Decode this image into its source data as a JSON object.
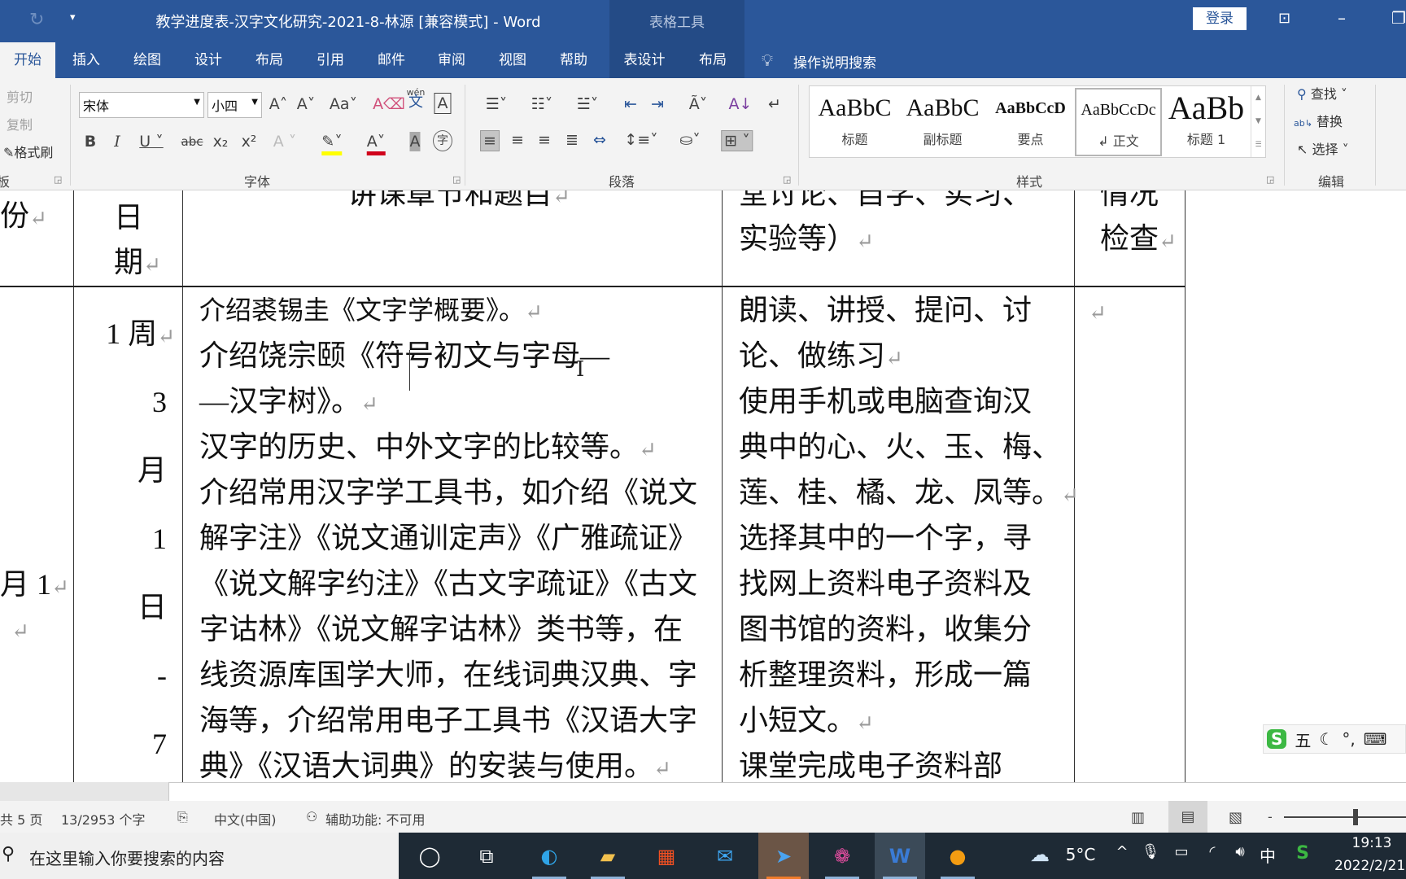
{
  "titlebar": {
    "title": "教学进度表-汉字文化研究-2021-8-林源 [兼容模式]  -  Word",
    "context_group": "表格工具",
    "signin": "登录",
    "qat_customize": "▾"
  },
  "tabs": [
    {
      "label": "开始",
      "selected": true
    },
    {
      "label": "插入"
    },
    {
      "label": "绘图"
    },
    {
      "label": "设计"
    },
    {
      "label": "布局"
    },
    {
      "label": "引用"
    },
    {
      "label": "邮件"
    },
    {
      "label": "审阅"
    },
    {
      "label": "视图"
    },
    {
      "label": "帮助"
    },
    {
      "label": "表设计"
    },
    {
      "label": "布局"
    }
  ],
  "tell_me": "操作说明搜索",
  "ribbon": {
    "clipboard": {
      "cut": "剪切",
      "copy": "复制",
      "format_painter": "格式刷",
      "label": "板"
    },
    "font": {
      "name": "宋体",
      "size": "小四",
      "label": "字体",
      "change_case": "Aa",
      "phonetic": "wén"
    },
    "paragraph": {
      "label": "段落"
    },
    "styles": {
      "label": "样式",
      "items": [
        {
          "preview": "AaBbC",
          "name": "标题"
        },
        {
          "preview": "AaBbC",
          "name": "副标题"
        },
        {
          "preview": "AaBbCcD",
          "name": "要点"
        },
        {
          "preview": "AaBbCcDc",
          "name": "↲ 正文",
          "selected": true
        },
        {
          "preview": "AaBb",
          "name": "标题 1"
        }
      ]
    },
    "editing": {
      "find": "查找",
      "replace": "替换",
      "select": "选择",
      "label": "编辑"
    }
  },
  "document": {
    "pilcrow": "↵",
    "header": {
      "col1": "份",
      "col2": [
        "日",
        "期"
      ],
      "col3": "讲课章节和题目",
      "col4": [
        "堂讨论、自学、实习、",
        "实验等）"
      ],
      "col5": [
        "情况",
        "检查"
      ]
    },
    "row1": {
      "col1": [
        "月 1",
        ""
      ],
      "col2": [
        "1 周",
        "3",
        "月",
        "1",
        "日",
        "-",
        "7"
      ],
      "col3": [
        "介绍裘锡圭《文字学概要》。",
        "介绍饶宗颐《符号初文与字母—",
        "—汉字树》。",
        "汉字的历史、中外文字的比较等。",
        "介绍常用汉字学工具书，如介绍《说文",
        "解字注》《说文通训定声》《广雅疏证》",
        "《说文解字约注》《古文字疏证》《古文",
        "字诂林》《说文解字诂林》类书等，在",
        "线资源库国学大师，在线词典汉典、字",
        "海等，介绍常用电子工具书《汉语大字",
        "典》《汉语大词典》的安装与使用。"
      ],
      "col4": [
        "朗读、讲授、提问、讨",
        "论、做练习",
        "使用手机或电脑查询汉",
        "典中的心、火、玉、梅、",
        "莲、桂、橘、龙、凤等。",
        "选择其中的一个字，寻",
        "找网上资料电子资料及",
        "图书馆的资料，收集分",
        "析整理资料，形成一篇",
        "小短文。",
        "课堂完成电子资料部"
      ],
      "col5": [
        ""
      ]
    }
  },
  "statusbar": {
    "pages": "共 5 页",
    "words": "13/2953 个字",
    "language": "中文(中国)",
    "accessibility": "辅助功能: 不可用"
  },
  "taskbar": {
    "search_placeholder": "在这里输入你要搜索的内容",
    "weather": "5°C",
    "ime": "中",
    "time": "19:13",
    "date": "2022/2/21"
  },
  "ime_toolbar": {
    "mode": "五",
    "punct": "°,"
  },
  "colors": {
    "word_blue": "#2b579a",
    "ribbon_bg": "#f3f3f3",
    "taskbar": "#1e2a35"
  }
}
